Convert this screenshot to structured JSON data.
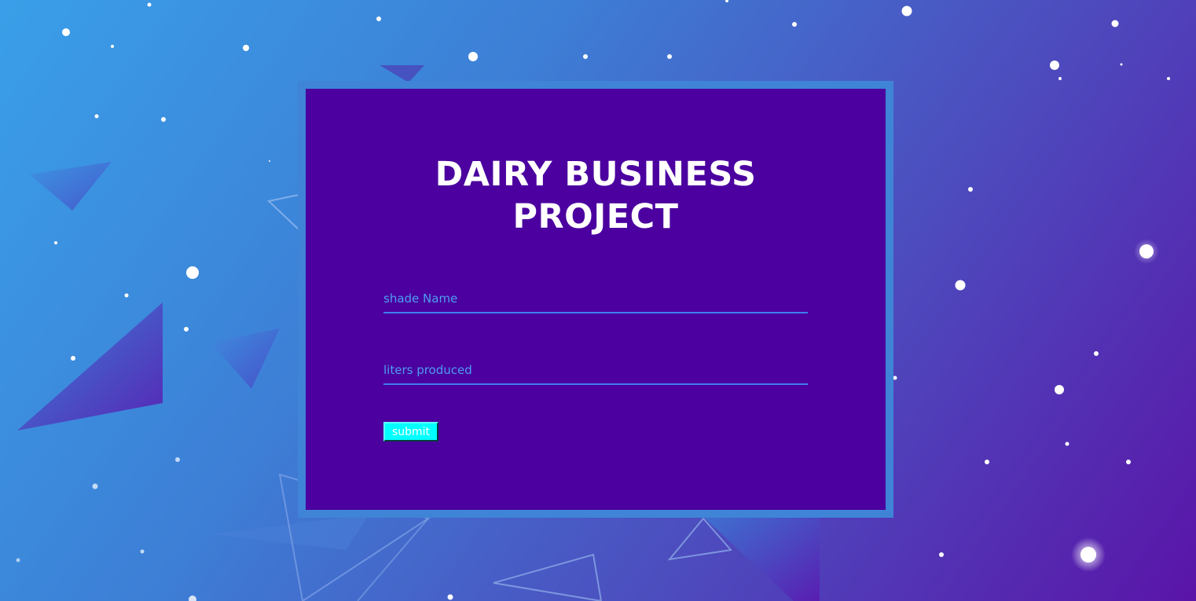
{
  "form": {
    "title_line1": "DAIRY BUSINESS",
    "title_line2": "PROJECT",
    "shade_name_placeholder": "shade Name",
    "liters_placeholder": "liters produced",
    "submit_label": "submit"
  },
  "colors": {
    "card_border": "#3f84d6",
    "card_fill": "#4b009f",
    "input_text": "#4f9cf2",
    "input_underline": "#3f7ef0",
    "submit_bg": "#00ffff",
    "submit_text": "#ffffff"
  }
}
